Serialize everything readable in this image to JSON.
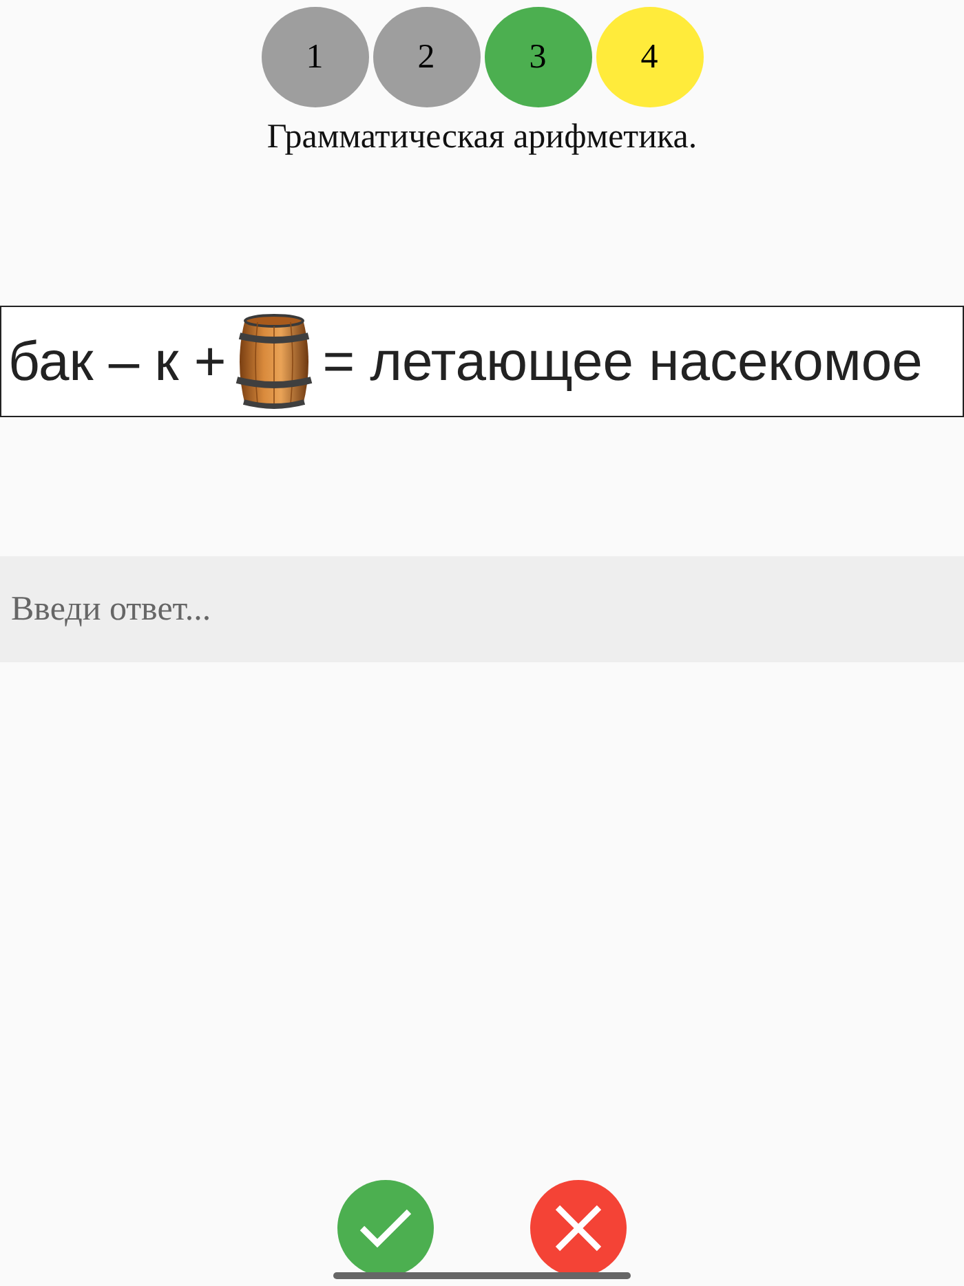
{
  "steps": [
    {
      "label": "1",
      "color": "#9e9e9e"
    },
    {
      "label": "2",
      "color": "#9e9e9e"
    },
    {
      "label": "3",
      "color": "#4caf50"
    },
    {
      "label": "4",
      "color": "#ffeb3b"
    }
  ],
  "title": "Грамматическая арифметика.",
  "riddle": {
    "parts": [
      {
        "kind": "text",
        "text": "бак – к +"
      },
      {
        "kind": "picture"
      },
      {
        "kind": "text",
        "text": "= летающее насекомое"
      }
    ]
  },
  "answer": {
    "placeholder": "Введи ответ..."
  },
  "actions": [
    {
      "kind": "confirm",
      "color": "#4caf50"
    },
    {
      "kind": "cancel",
      "color": "#f44336"
    }
  ]
}
